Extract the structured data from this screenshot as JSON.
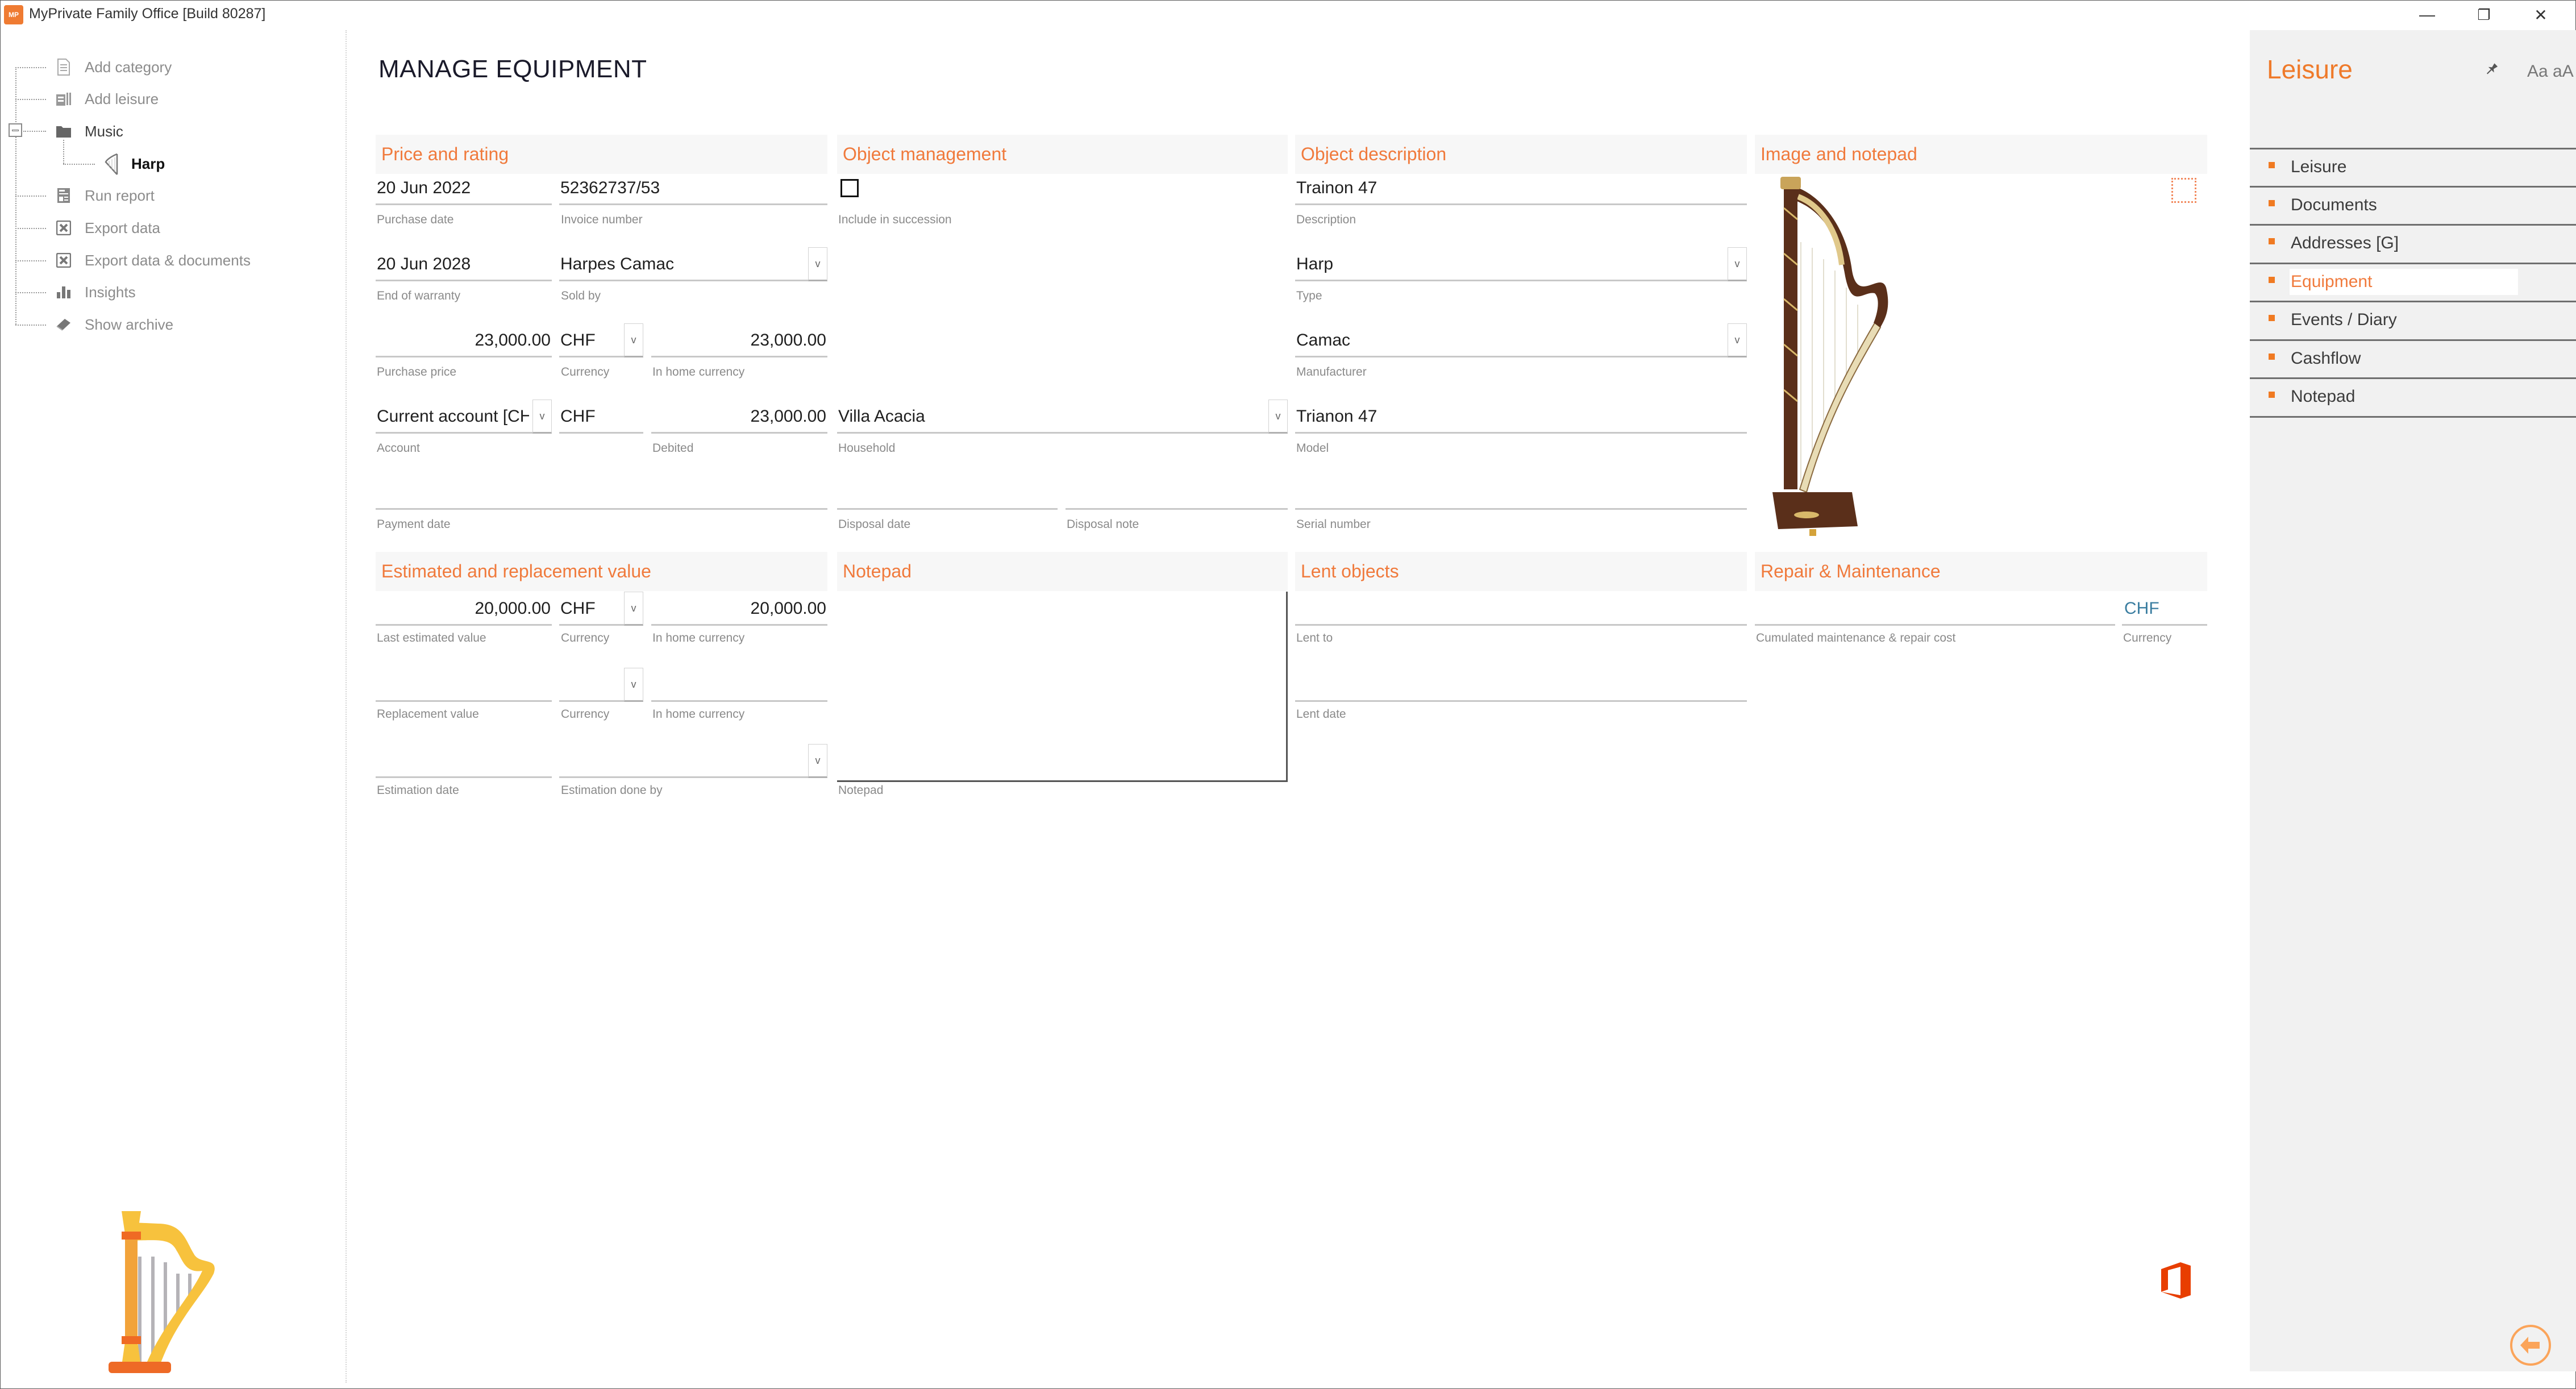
{
  "window": {
    "title": "MyPrivate Family Office [Build 80287]",
    "app_icon_label": "MP",
    "controls": {
      "minimize": "—",
      "restore": "❐",
      "close": "✕"
    }
  },
  "tree": {
    "items": [
      {
        "label": "Add category",
        "icon": "document-list-icon"
      },
      {
        "label": "Add leisure",
        "icon": "add-documents-icon"
      },
      {
        "label": "Music",
        "icon": "folder-icon"
      },
      {
        "label": "Harp",
        "icon": "harp-icon"
      },
      {
        "label": "Run report",
        "icon": "report-icon"
      },
      {
        "label": "Export data",
        "icon": "excel-export-icon"
      },
      {
        "label": "Export data & documents",
        "icon": "excel-export-icon"
      },
      {
        "label": "Insights",
        "icon": "bar-chart-icon"
      },
      {
        "label": "Show archive",
        "icon": "archive-book-icon"
      }
    ]
  },
  "main": {
    "title": "MANAGE EQUIPMENT",
    "sections": {
      "price": "Price and rating",
      "object_mgmt": "Object management",
      "object_desc": "Object description",
      "image": "Image and notepad",
      "estimated": "Estimated and replacement value",
      "notepad": "Notepad",
      "lent": "Lent objects",
      "repair": "Repair & Maintenance"
    },
    "price": {
      "purchase_date": {
        "label": "Purchase date",
        "value": "20 Jun 2022"
      },
      "invoice_number": {
        "label": "Invoice number",
        "value": "52362737/53"
      },
      "end_of_warranty": {
        "label": "End of warranty",
        "value": "20 Jun 2028"
      },
      "sold_by": {
        "label": "Sold by",
        "value": "Harpes Camac"
      },
      "purchase_price": {
        "label": "Purchase price",
        "value": "23,000.00"
      },
      "currency": {
        "label": "Currency",
        "value": "CHF"
      },
      "in_home_currency": {
        "label": "In home currency",
        "value": "23,000.00"
      },
      "account": {
        "label": "Account",
        "value": "Current account [CH"
      },
      "account_currency": {
        "label": "",
        "value": "CHF"
      },
      "debited": {
        "label": "Debited",
        "value": "23,000.00"
      },
      "payment_date": {
        "label": "Payment date",
        "value": ""
      }
    },
    "object_mgmt": {
      "include_in_succession": {
        "label": "Include in succession",
        "checked": false
      },
      "household": {
        "label": "Household",
        "value": "Villa Acacia"
      },
      "disposal_date": {
        "label": "Disposal date",
        "value": ""
      },
      "disposal_note": {
        "label": "Disposal note",
        "value": ""
      }
    },
    "object_desc": {
      "description": {
        "label": "Description",
        "value": "Trainon 47"
      },
      "type": {
        "label": "Type",
        "value": "Harp"
      },
      "manufacturer": {
        "label": "Manufacturer",
        "value": "Camac"
      },
      "model": {
        "label": "Model",
        "value": "Trianon 47"
      },
      "serial_number": {
        "label": "Serial number",
        "value": ""
      }
    },
    "estimated": {
      "last_estimated_value": {
        "label": "Last estimated value",
        "value": "20,000.00"
      },
      "currency": {
        "label": "Currency",
        "value": "CHF"
      },
      "in_home_currency": {
        "label": "In home currency",
        "value": "20,000.00"
      },
      "replacement_value": {
        "label": "Replacement value",
        "value": ""
      },
      "replacement_currency": {
        "label": "Currency",
        "value": ""
      },
      "replacement_home": {
        "label": "In home currency",
        "value": ""
      },
      "estimation_date": {
        "label": "Estimation date",
        "value": ""
      },
      "estimation_done_by": {
        "label": "Estimation done by",
        "value": ""
      }
    },
    "notepad": {
      "label": "Notepad",
      "value": ""
    },
    "lent": {
      "lent_to": {
        "label": "Lent to",
        "value": ""
      },
      "lent_date": {
        "label": "Lent date",
        "value": ""
      }
    },
    "repair": {
      "cumulated_cost": {
        "label": "Cumulated maintenance & repair cost",
        "value": ""
      },
      "currency": {
        "label": "Currency",
        "value": "CHF"
      }
    },
    "dropdown_glyph": "v"
  },
  "right_panel": {
    "title": "Leisure",
    "pin_icon": "📌",
    "font_size_toggle": "Aa aA",
    "items": [
      {
        "label": "Leisure",
        "active": false
      },
      {
        "label": "Documents",
        "active": false
      },
      {
        "label": "Addresses [G]",
        "active": false
      },
      {
        "label": "Equipment",
        "active": true
      },
      {
        "label": "Events / Diary",
        "active": false
      },
      {
        "label": "Cashflow",
        "active": false
      },
      {
        "label": "Notepad",
        "active": false
      }
    ]
  },
  "colors": {
    "accent": "#f07a3c",
    "brand_orange": "#ef7a2a",
    "section_header_bg": "#f7f7f7",
    "right_panel_bg": "#f1f1f1",
    "currency_link": "#3a7da0",
    "office_logo": "#e83e00"
  }
}
